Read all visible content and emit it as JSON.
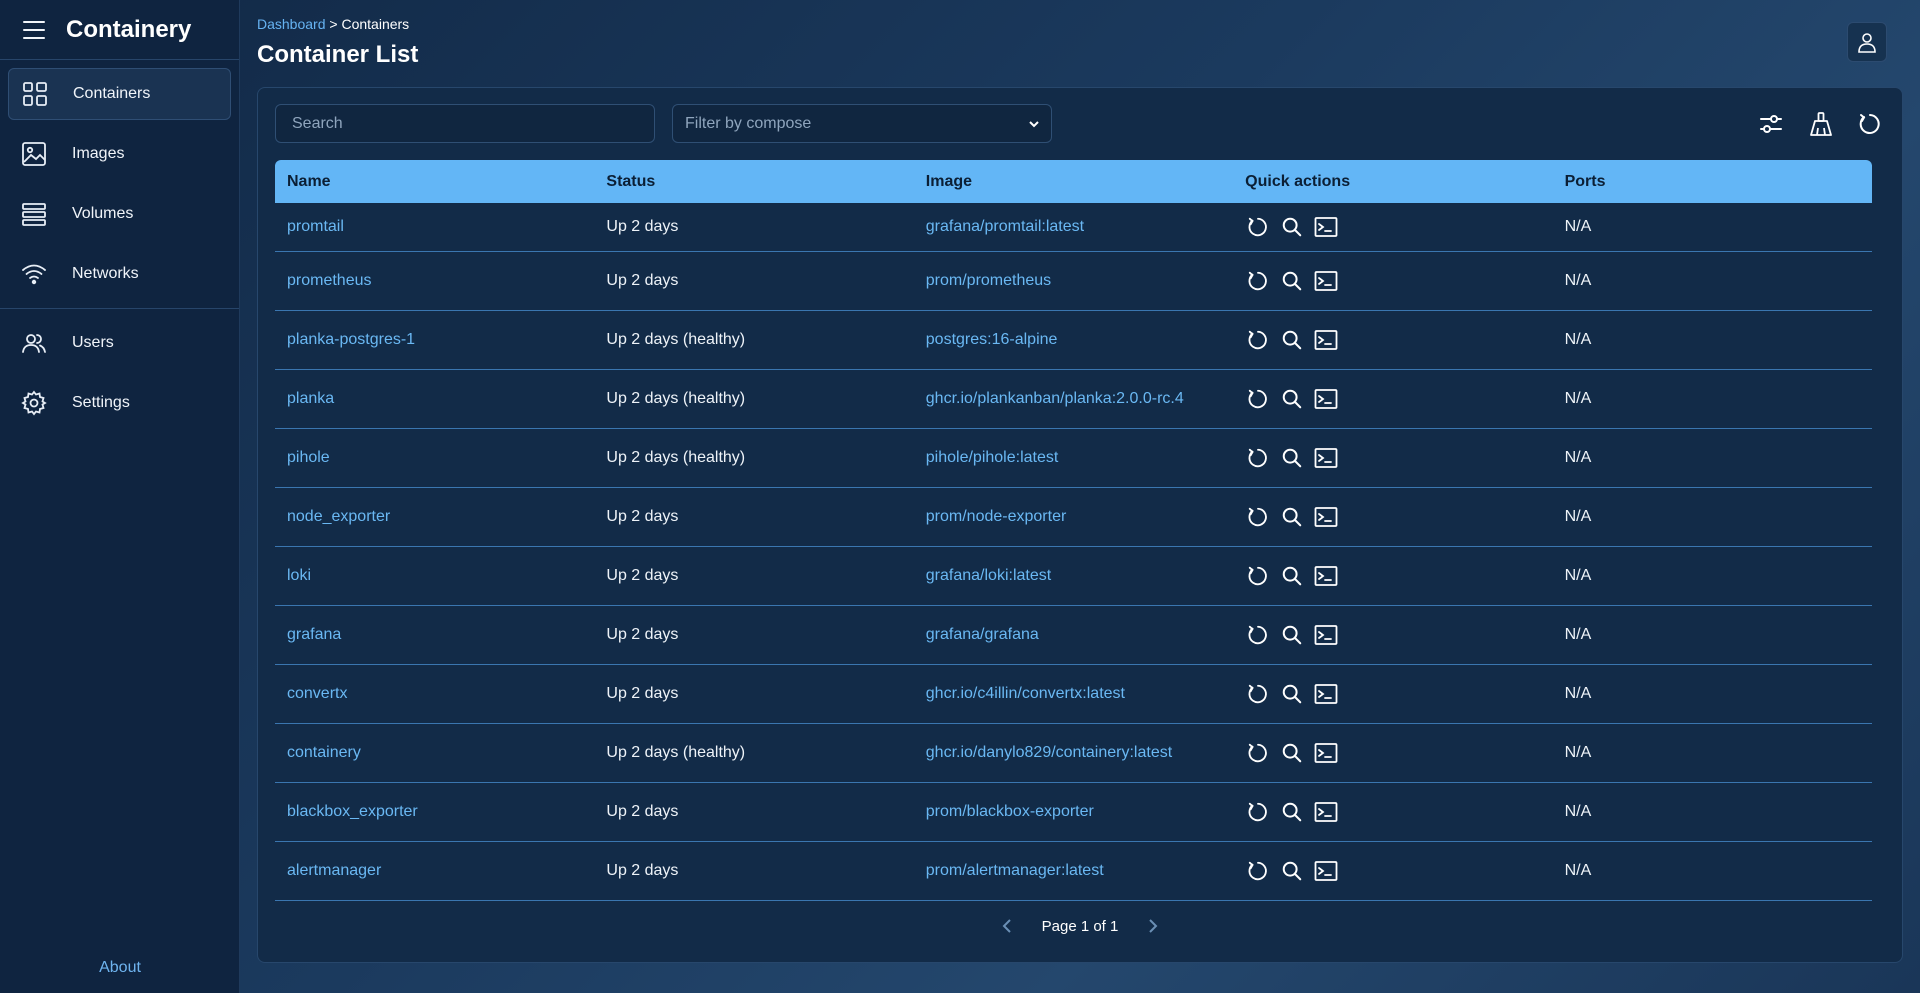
{
  "app": {
    "title": "Containery"
  },
  "sidebar": {
    "items": [
      {
        "label": "Containers",
        "icon": "grid-icon",
        "active": true
      },
      {
        "label": "Images",
        "icon": "image-icon"
      },
      {
        "label": "Volumes",
        "icon": "stack-icon"
      },
      {
        "label": "Networks",
        "icon": "wifi-icon"
      },
      {
        "label": "Users",
        "icon": "users-icon"
      },
      {
        "label": "Settings",
        "icon": "gear-icon"
      }
    ],
    "about": "About"
  },
  "breadcrumb": {
    "root": "Dashboard",
    "separator": " > ",
    "current": "Containers"
  },
  "page": {
    "title": "Container List"
  },
  "toolbar": {
    "search_placeholder": "Search",
    "filter_placeholder": "Filter by compose",
    "tools": [
      "sliders-icon",
      "broom-icon",
      "refresh-icon"
    ]
  },
  "table": {
    "headers": [
      "Name",
      "Status",
      "Image",
      "Quick actions",
      "Ports"
    ],
    "rows": [
      {
        "name": "promtail",
        "status": "Up 2 days",
        "image": "grafana/promtail:latest",
        "ports": "N/A"
      },
      {
        "name": "prometheus",
        "status": "Up 2 days",
        "image": "prom/prometheus",
        "ports": "N/A"
      },
      {
        "name": "planka-postgres-1",
        "status": "Up 2 days (healthy)",
        "image": "postgres:16-alpine",
        "ports": "N/A"
      },
      {
        "name": "planka",
        "status": "Up 2 days (healthy)",
        "image": "ghcr.io/plankanban/planka:2.0.0-rc.4",
        "ports": "N/A"
      },
      {
        "name": "pihole",
        "status": "Up 2 days (healthy)",
        "image": "pihole/pihole:latest",
        "ports": "N/A"
      },
      {
        "name": "node_exporter",
        "status": "Up 2 days",
        "image": "prom/node-exporter",
        "ports": "N/A"
      },
      {
        "name": "loki",
        "status": "Up 2 days",
        "image": "grafana/loki:latest",
        "ports": "N/A"
      },
      {
        "name": "grafana",
        "status": "Up 2 days",
        "image": "grafana/grafana",
        "ports": "N/A"
      },
      {
        "name": "convertx",
        "status": "Up 2 days",
        "image": "ghcr.io/c4illin/convertx:latest",
        "ports": "N/A"
      },
      {
        "name": "containery",
        "status": "Up 2 days (healthy)",
        "image": "ghcr.io/danylo829/containery:latest",
        "ports": "N/A"
      },
      {
        "name": "blackbox_exporter",
        "status": "Up 2 days",
        "image": "prom/blackbox-exporter",
        "ports": "N/A"
      },
      {
        "name": "alertmanager",
        "status": "Up 2 days",
        "image": "prom/alertmanager:latest",
        "ports": "N/A"
      }
    ],
    "quick_actions": [
      "restart-icon",
      "inspect-icon",
      "terminal-icon"
    ]
  },
  "pagination": {
    "text": "Page 1 of 1"
  },
  "colors": {
    "accent": "#63b6f6",
    "link": "#6ab8f3",
    "sidebar_bg": "#0f2440",
    "panel_bg": "#122b48"
  }
}
